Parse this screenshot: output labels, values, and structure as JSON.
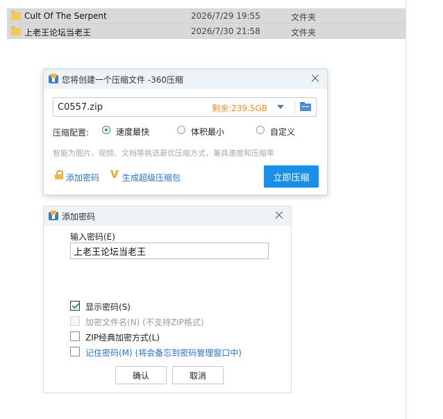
{
  "explorer": {
    "rows": [
      {
        "name": "Cult Of The Serpent",
        "date": "2026/7/29 19:55",
        "type": "文件夹"
      },
      {
        "name": "上老王论坛当老王",
        "date": "2026/7/30 21:58",
        "type": "文件夹"
      }
    ]
  },
  "compress_dialog": {
    "title": "您将创建一个压缩文件 -360压缩",
    "filename": "C0557.zip",
    "free_space": "剩余:239.5GB",
    "config_label": "压缩配置:",
    "options": [
      "速度最快",
      "体积最小",
      "自定义"
    ],
    "selected_option": "速度最快",
    "hint": "智能为图片、视频、文档等挑选最优压缩方式，兼具速度和压缩率",
    "add_password_link": "添加密码",
    "super_package_link": "生成超级压缩包",
    "compress_button": "立即压缩",
    "accent_color": "#1a8fe8"
  },
  "password_dialog": {
    "title": "添加密码",
    "input_label": "输入密码(E)",
    "password_value": "上老王论坛当老王",
    "show_password": "显示密码(S)",
    "encrypt_filenames": "加密文件名(N) (不支持ZIP格式)",
    "zip_classic": "ZIP经典加密方式(L)",
    "remember_password": "记住密码(M) (将会备忘到密码管理窗口中)",
    "ok_button": "确认",
    "cancel_button": "取消"
  }
}
